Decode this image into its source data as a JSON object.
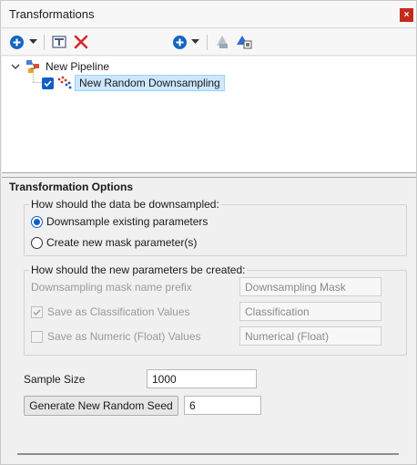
{
  "window": {
    "title": "Transformations",
    "close_label": "×"
  },
  "toolbar": {
    "icons": [
      "add-icon",
      "dropdown-arrow-icon",
      "rename-icon",
      "delete-icon",
      "add-icon",
      "dropdown-arrow-icon",
      "move-up-icon",
      "copy-icon"
    ],
    "colors": {
      "add": "#1565c0",
      "delete": "#d9262b",
      "disabled": "#9aa6b2"
    }
  },
  "tree": {
    "root": {
      "label": "New Pipeline",
      "expanded": true
    },
    "child": {
      "label": "New Random Downsampling",
      "checked": true,
      "selected": true
    }
  },
  "options": {
    "title": "Transformation Options",
    "downsample_group": {
      "legend": "How should the data be downsampled:",
      "options": [
        {
          "label": "Downsample existing parameters",
          "selected": true
        },
        {
          "label": "Create new mask parameter(s)",
          "selected": false
        }
      ]
    },
    "new_params_group": {
      "legend": "How should the new parameters be created:",
      "mask_prefix_label": "Downsampling mask name prefix",
      "mask_prefix_value": "Downsampling Mask",
      "classification": {
        "label": "Save as Classification Values",
        "checked": true,
        "value": "Classification"
      },
      "numeric": {
        "label": "Save as Numeric (Float) Values",
        "checked": false,
        "value": "Numerical (Float)"
      }
    },
    "sample_size": {
      "label": "Sample Size",
      "value": "1000"
    },
    "seed": {
      "button_label": "Generate New Random Seed",
      "value": "6"
    }
  }
}
